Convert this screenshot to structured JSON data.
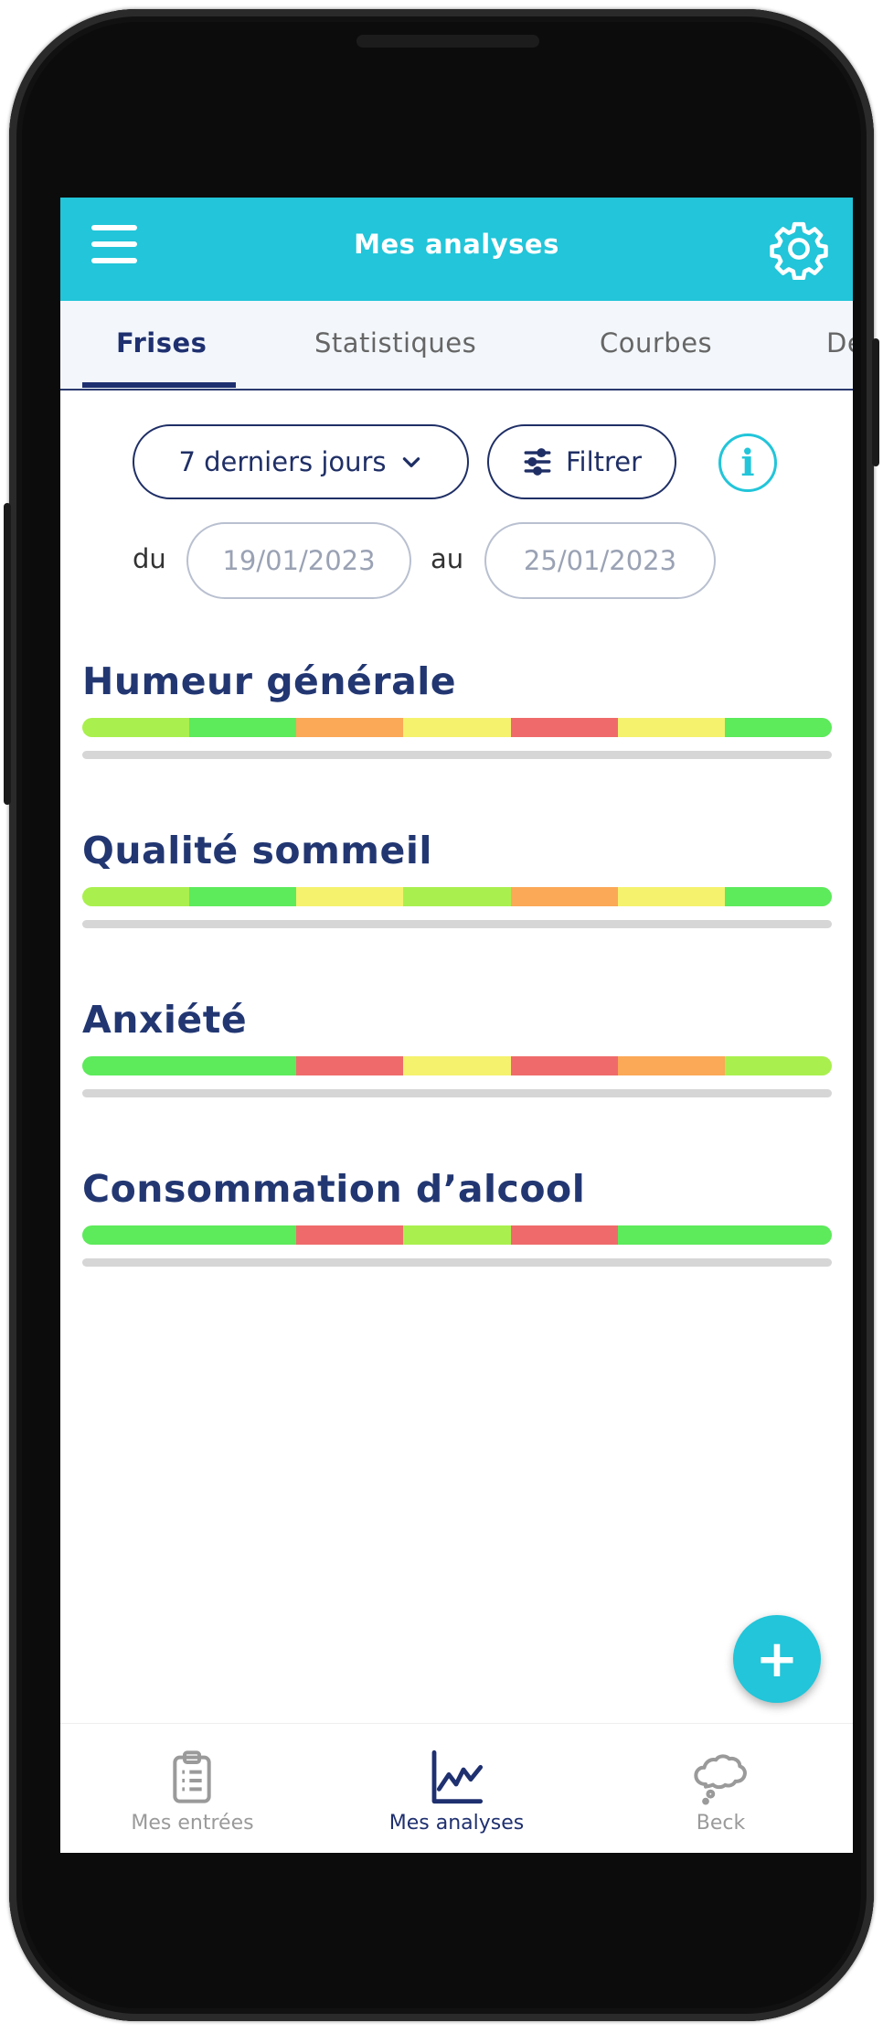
{
  "app_bar": {
    "title": "Mes analyses",
    "menu_icon": "menu-icon",
    "settings_icon": "gear-icon"
  },
  "tabs": [
    {
      "label": "Frises",
      "active": true
    },
    {
      "label": "Statistiques",
      "active": false
    },
    {
      "label": "Courbes",
      "active": false
    },
    {
      "label": "De",
      "active": false
    }
  ],
  "filters": {
    "period_label": "7 derniers jours",
    "filter_label": "Filtrer",
    "info_glyph": "i",
    "from_label": "du",
    "from_date": "19/01/2023",
    "to_label": "au",
    "to_date": "25/01/2023"
  },
  "colors": {
    "accent": "#22c5d9",
    "primary": "#1f3070",
    "lime": "#a9f04e",
    "green": "#5dea5b",
    "orange": "#fba857",
    "yellow": "#f5f26e",
    "red": "#ef6b6b"
  },
  "frises": [
    {
      "title": "Humeur générale",
      "segments": [
        "lime",
        "green",
        "orange",
        "yellow",
        "red",
        "yellow",
        "green"
      ]
    },
    {
      "title": "Qualité sommeil",
      "segments": [
        "lime",
        "green",
        "yellow",
        "lime",
        "orange",
        "yellow",
        "green"
      ]
    },
    {
      "title": "Anxiété",
      "segments": [
        "green",
        "green",
        "red",
        "yellow",
        "red",
        "orange",
        "lime"
      ]
    },
    {
      "title": "Consommation d’alcool",
      "segments": [
        "green",
        "green",
        "red",
        "lime",
        "red",
        "green",
        "green"
      ]
    }
  ],
  "fab": {
    "icon": "plus-icon",
    "glyph": "+"
  },
  "bottom_nav": [
    {
      "label": "Mes entrées",
      "icon": "clipboard-icon",
      "active": false
    },
    {
      "label": "Mes analyses",
      "icon": "line-chart-icon",
      "active": true
    },
    {
      "label": "Beck",
      "icon": "thought-cloud-icon",
      "active": false
    }
  ]
}
